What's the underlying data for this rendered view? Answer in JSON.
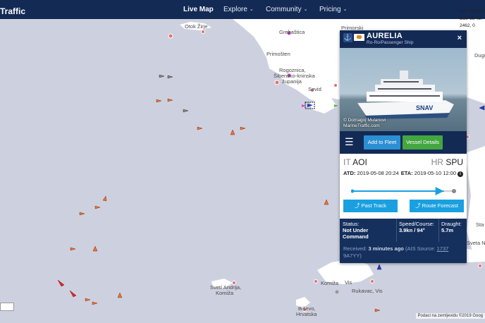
{
  "header": {
    "brand": "Traffic",
    "nav": [
      {
        "label": "Live Map",
        "has_menu": false,
        "active": true
      },
      {
        "label": "Explore",
        "has_menu": true,
        "active": false
      },
      {
        "label": "Community",
        "has_menu": true,
        "active": false
      },
      {
        "label": "Pricing",
        "has_menu": true,
        "active": false
      }
    ],
    "chevron": "⌄"
  },
  "map": {
    "places": [
      "Otok Žirje",
      "Grebaštica",
      "Primorski",
      "Primošten",
      "Rogoznica,",
      "Šibensko-kninska",
      "županija",
      "Sevid",
      "Dugo",
      "Svetí Andrija,",
      "Komiža",
      "Komiža",
      "Vis",
      "Rukavac, Vis",
      "Biševo,",
      "Hrvatska",
      "Sveta N",
      "Sta"
    ],
    "coords_lines": [
      "N43°14'46.3",
      "E16°38'48.",
      "2462, 0"
    ],
    "attribution": "Podaci na zemljevidu ©2019 Goog",
    "colors": {
      "sea": "#cdd1df",
      "land": "#ffffff",
      "cargo": "#e8703a",
      "passenger": "#1e3fbf",
      "tanker": "#e02a2a"
    }
  },
  "vessel": {
    "name": "AURELIA",
    "type": "Ro-Ro/Passenger Ship",
    "photo_credit": "© Domagoj Mulanovi",
    "photo_source": "MarineTraffic.com",
    "hull_text": "SNAV",
    "add_to_fleet": "Add to Fleet",
    "vessel_details": "Vessel Details",
    "from_country": "IT",
    "from_port": "AOI",
    "to_country": "HR",
    "to_port": "SPU",
    "atd_label": "ATD:",
    "atd_value": "2019-05-08 20:24",
    "eta_label": "ETA:",
    "eta_value": "2019-05-10 12:00",
    "voyage_progress": 0.9,
    "past_track": "Past Track",
    "route_forecast": "Route Forecast",
    "status_label": "Status:",
    "status_value": "Not Under Command",
    "speed_label": "Speed/Course:",
    "speed_value": "3.9kn / 94°",
    "draught_label": "Draught:",
    "draught_value": "5.7m",
    "received_label": "Received:",
    "received_value": "3 minutes ago",
    "ais_source": "(AIS Source:",
    "ais_id": "1737",
    "ais_tail": "9A7YY)"
  }
}
